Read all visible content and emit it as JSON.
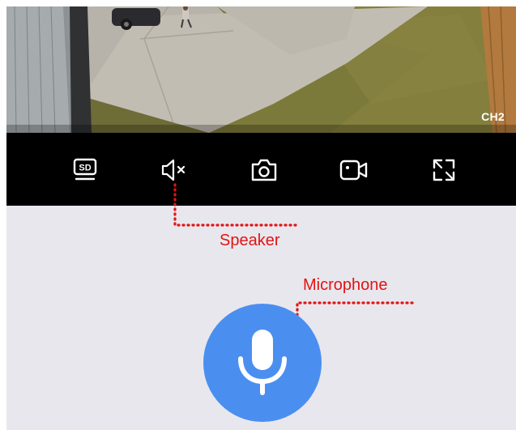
{
  "video": {
    "channel_label": "CH2"
  },
  "toolbar": {
    "buttons": [
      {
        "icon": "sd-quality-icon",
        "label": "SD"
      },
      {
        "icon": "speaker-muted-icon"
      },
      {
        "icon": "camera-snapshot-icon"
      },
      {
        "icon": "video-record-icon"
      },
      {
        "icon": "fullscreen-icon"
      }
    ]
  },
  "annotations": {
    "speaker_label": "Speaker",
    "microphone_label": "Microphone",
    "color": "#e11414"
  },
  "microphone": {
    "icon": "microphone-icon",
    "color": "#4a8ff0"
  }
}
